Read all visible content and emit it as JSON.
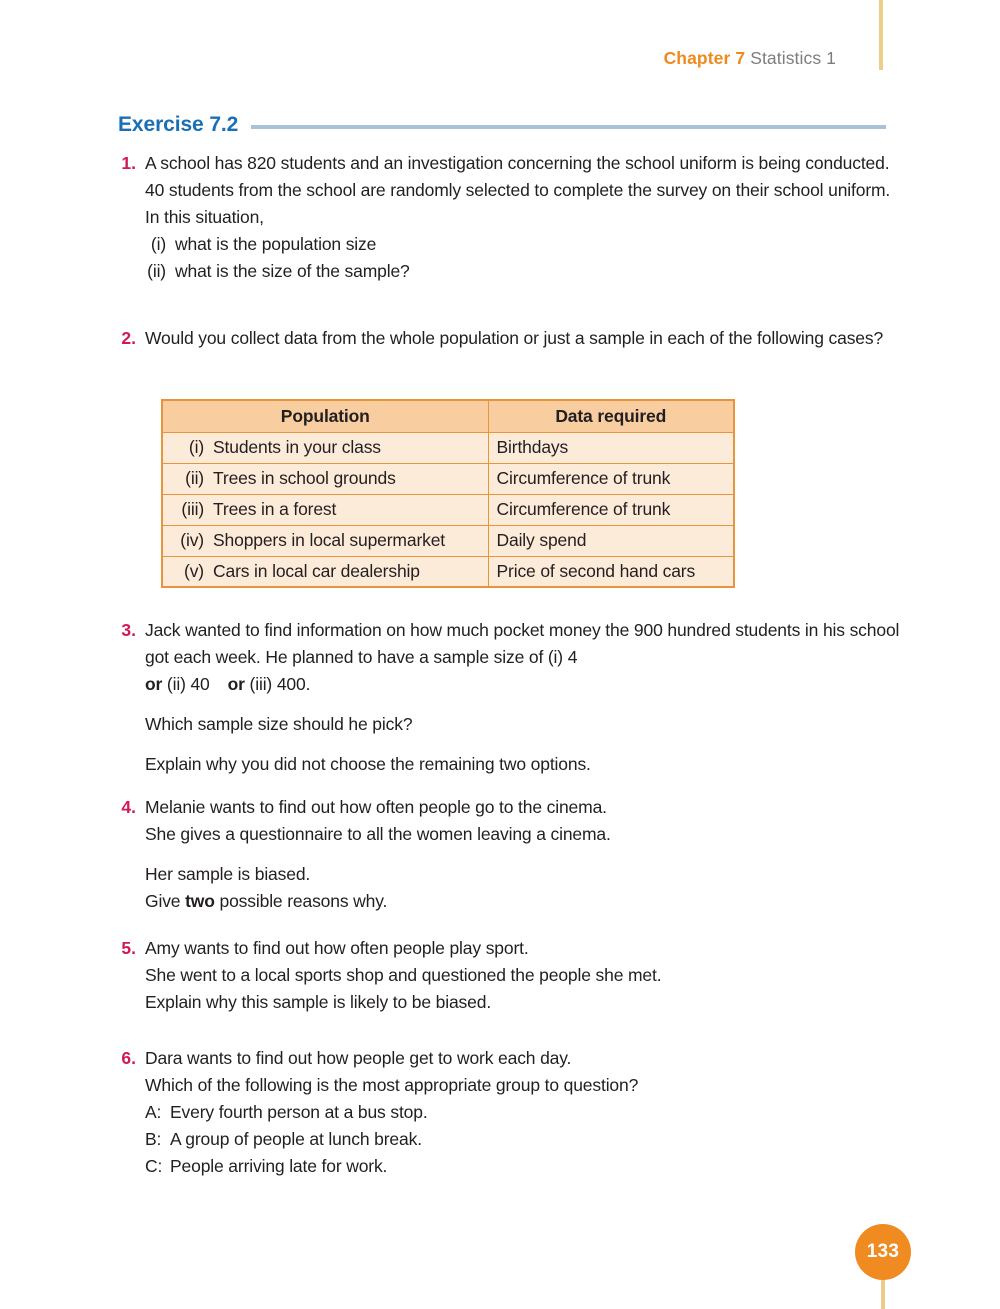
{
  "header": {
    "chapter": "Chapter 7",
    "subject": "Statistics 1"
  },
  "exercise": {
    "title": "Exercise 7.2"
  },
  "questions": [
    {
      "number": "1.",
      "lines": [
        "A school has 820 students and an investigation concerning the school uniform is being conducted.",
        "40 students from the school are randomly selected to complete the survey on their school uniform. In this situation,"
      ],
      "sub_items": [
        {
          "marker": "(i)",
          "text": "what is the population size"
        },
        {
          "marker": "(ii)",
          "text": "what is the size of the sample?"
        }
      ]
    },
    {
      "number": "2.",
      "lines": [
        "Would you collect data from the whole population or just a sample in each of the following cases?"
      ]
    },
    {
      "number": "3.",
      "line_a": "Jack wanted to find information on how much pocket money the 900 hundred students in his school got each week. He planned to have a sample size of (i) 4",
      "bold_or_1": "or",
      "mid_1": " (ii) 40",
      "bold_or_2": "or",
      "mid_2": " (iii) 400.",
      "line_b": "Which sample size should he pick?",
      "line_c": "Explain why you did not choose the remaining two options."
    },
    {
      "number": "4.",
      "line_a": "Melanie wants to find out how often people go to the cinema.",
      "line_b": "She gives a questionnaire to all the women leaving a cinema.",
      "line_c": "Her sample is biased.",
      "line_d_pre": "Give ",
      "line_d_bold": "two",
      "line_d_post": " possible reasons why."
    },
    {
      "number": "5.",
      "lines": [
        "Amy wants to find out how often people play sport.",
        "She went to a local sports shop and questioned the people she met.",
        "Explain why this sample is likely to be biased."
      ]
    },
    {
      "number": "6.",
      "lines": [
        "Dara wants to find out how people get to work each day.",
        "Which of the following is the most appropriate group to question?"
      ],
      "options": [
        {
          "marker": "A:",
          "text": "Every fourth person at a bus stop."
        },
        {
          "marker": "B:",
          "text": "A group of people at lunch break."
        },
        {
          "marker": "C:",
          "text": "People arriving late for work."
        }
      ]
    }
  ],
  "table": {
    "headers": [
      "Population",
      "Data required"
    ],
    "rows": [
      {
        "marker": "(i)",
        "population": "Students in your class",
        "data_required": "Birthdays"
      },
      {
        "marker": "(ii)",
        "population": "Trees in school grounds",
        "data_required": "Circumference of trunk"
      },
      {
        "marker": "(iii)",
        "population": "Trees in a forest",
        "data_required": "Circumference of trunk"
      },
      {
        "marker": "(iv)",
        "population": "Shoppers in local supermarket",
        "data_required": "Daily spend"
      },
      {
        "marker": "(v)",
        "population": "Cars in local car dealership",
        "data_required": "Price of second hand cars"
      }
    ]
  },
  "page_number": "133",
  "colors": {
    "accent_blue": "#1a6fb5",
    "rule_blue": "#a7c3dc",
    "question_number_red": "#d1185b",
    "chapter_orange": "#ee8a1e",
    "subject_gray": "#7d7d7d",
    "table_header_bg": "#f8cda0",
    "table_body_bg": "#fdebd9",
    "table_border": "#e8943c",
    "page_badge": "#ef8b21",
    "gold_bar": "#ebce87"
  }
}
